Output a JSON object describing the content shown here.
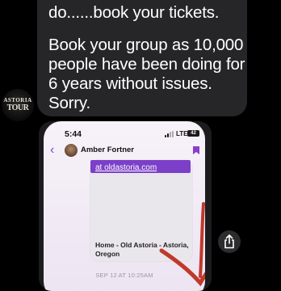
{
  "message": {
    "line1": "do......book your tickets.",
    "line2": "Book your group as 10,000 people have been doing for 6 years without issues. Sorry."
  },
  "sender_avatar": {
    "logo_top": "ASTORIA",
    "logo_bottom": "TOUR"
  },
  "screenshot": {
    "time": "5:44",
    "network": "LTE",
    "battery": "42",
    "contact_name": "Amber Fortner",
    "link_prefix": "at ",
    "link": "oldastoria.com",
    "card_title": "Home - Old Astoria - Astoria, Oregon",
    "timestamp": "SEP 12 AT 10:25AM"
  },
  "colors": {
    "bubble": "#262628",
    "accent_purple": "#7b3fc8",
    "arrow_red": "#c0392b"
  },
  "icons": {
    "share": "share-icon",
    "back": "chevron-left-icon",
    "bookmark": "bookmark-icon"
  }
}
